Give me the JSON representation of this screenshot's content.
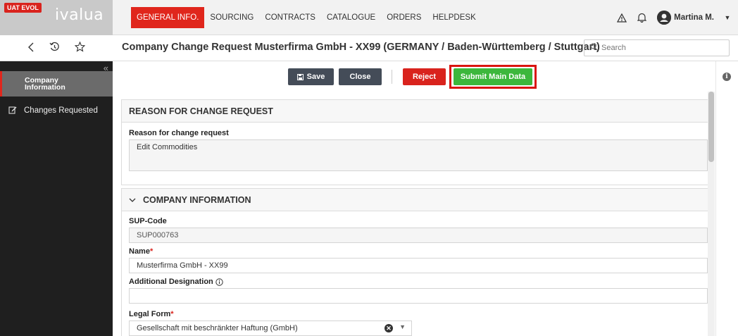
{
  "app": {
    "env_badge": "UAT EVOL",
    "logo": "ivalua"
  },
  "nav": {
    "items": [
      {
        "label": "GENERAL INFO.",
        "active": true
      },
      {
        "label": "SOURCING",
        "active": false
      },
      {
        "label": "CONTRACTS",
        "active": false
      },
      {
        "label": "CATALOGUE",
        "active": false
      },
      {
        "label": "ORDERS",
        "active": false
      },
      {
        "label": "HELPDESK",
        "active": false
      }
    ],
    "icons": [
      "warning-icon",
      "bell-icon",
      "user-avatar-icon"
    ],
    "user_name": "Martina M."
  },
  "header": {
    "title": "Company Change Request Musterfirma GmbH - XX99 (GERMANY / Baden-Württemberg / Stuttgart)",
    "search_placeholder": "Search",
    "icons": [
      "back-icon",
      "history-icon",
      "star-icon"
    ]
  },
  "sidebar": {
    "items": [
      {
        "label": "Company Information",
        "active": true,
        "icon": "none"
      },
      {
        "label": "Changes Requested",
        "active": false,
        "icon": "edit-icon"
      }
    ]
  },
  "toolbar": {
    "save_label": "Save",
    "close_label": "Close",
    "reject_label": "Reject",
    "submit_label": "Submit Main Data"
  },
  "sections": {
    "reason": {
      "title": "REASON FOR CHANGE REQUEST",
      "label": "Reason for change request",
      "value": "Edit Commodities"
    },
    "company": {
      "title": "COMPANY INFORMATION",
      "sup_code_label": "SUP-Code",
      "sup_code_value": "SUP000763",
      "name_label": "Name",
      "name_value": "Musterfirma GmbH - XX99",
      "additional_label": "Additional Designation",
      "additional_value": "",
      "legal_form_label": "Legal Form",
      "legal_form_value": "Gesellschaft mit beschränkter Haftung (GmbH)",
      "required_mark": "*"
    }
  },
  "colors": {
    "brand_red": "#e0261c",
    "submit_green": "#3cb73c",
    "dark_button": "#444c58",
    "sidebar_bg": "#1f1f1f",
    "highlight": "#d9140f"
  }
}
